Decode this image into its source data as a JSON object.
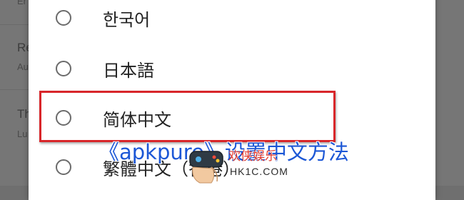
{
  "background_page": {
    "items": [
      {
        "title": "",
        "subtitle": "Er"
      },
      {
        "title": "Re",
        "subtitle": "Au"
      },
      {
        "title": "Th",
        "subtitle": "Lu"
      }
    ]
  },
  "language_dialog": {
    "options": [
      {
        "label": "한국어",
        "selected": false
      },
      {
        "label": "日本語",
        "selected": false
      },
      {
        "label": "简体中文",
        "selected": false
      },
      {
        "label": "繁體中文（香港）",
        "selected": false
      }
    ],
    "highlighted_option_index": 2
  },
  "caption": {
    "text": "《apkpure》设置中文方法"
  },
  "watermark": {
    "title": "欢侠娱乐",
    "site": "HK1C.COM"
  },
  "colors": {
    "highlight": "#d8262a",
    "caption": "#1c57d6",
    "watermark_title": "#e23b2e",
    "dim_background": "#767676"
  }
}
